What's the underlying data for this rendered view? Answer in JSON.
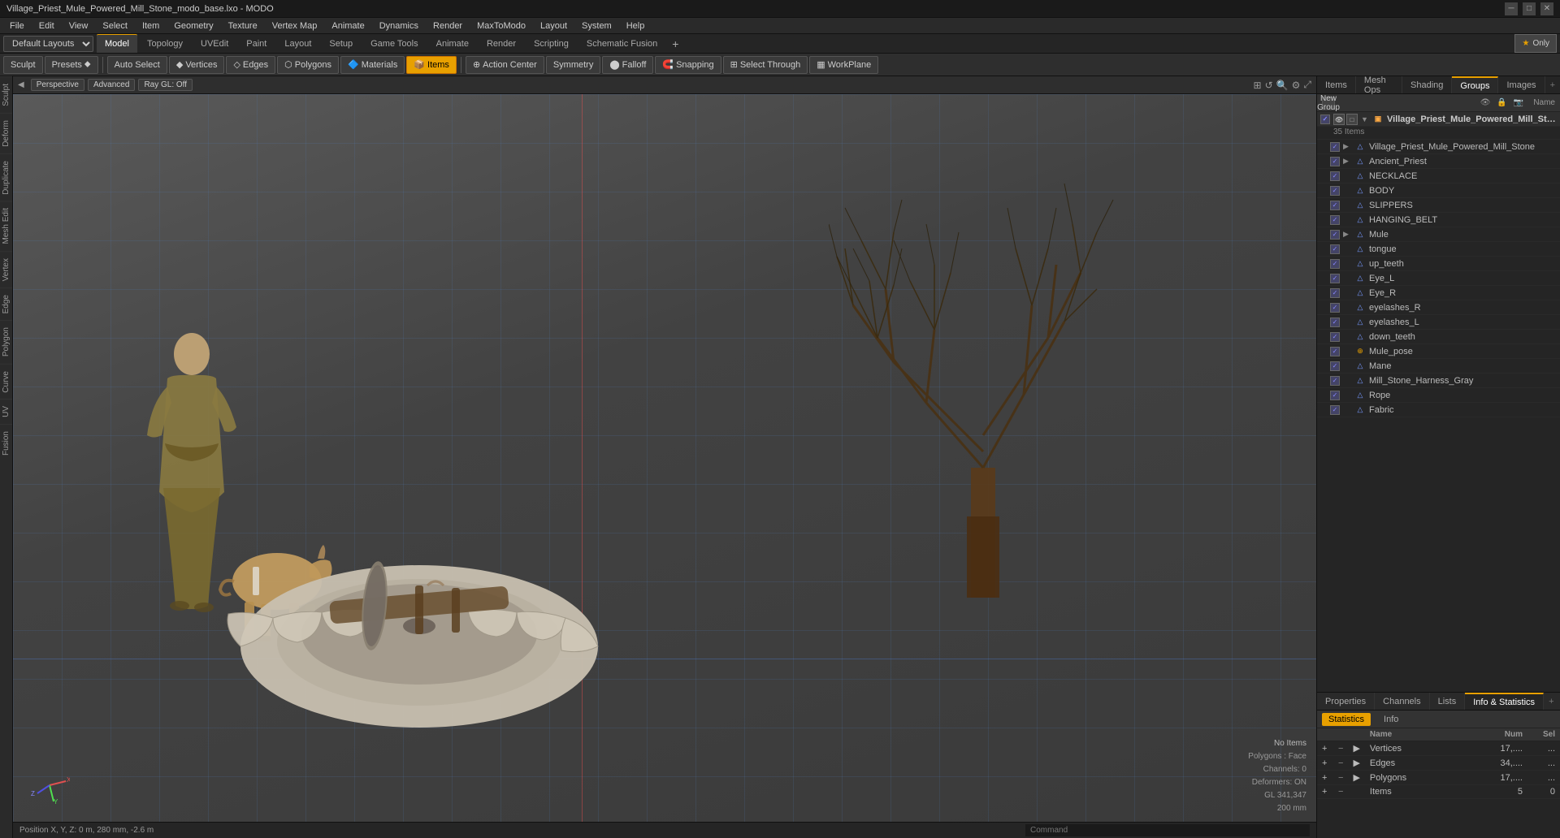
{
  "titlebar": {
    "title": "Village_Priest_Mule_Powered_Mill_Stone_modo_base.lxo - MODO",
    "minimize": "─",
    "maximize": "□",
    "close": "✕"
  },
  "menubar": {
    "items": [
      "File",
      "Edit",
      "View",
      "Select",
      "Item",
      "Geometry",
      "Texture",
      "Vertex Map",
      "Animate",
      "Dynamics",
      "Render",
      "MaxToModo",
      "Layout",
      "System",
      "Help"
    ]
  },
  "layout": {
    "dropdown_label": "Default Layouts",
    "tabs": [
      "Model",
      "Topology",
      "UVEdit",
      "Paint",
      "Layout",
      "Setup",
      "Game Tools",
      "Animate",
      "Render",
      "Scripting",
      "Schematic Fusion"
    ],
    "active_tab": "Model",
    "plus_label": "+",
    "only_btn": "Only",
    "star": "★"
  },
  "toolbar": {
    "sculpt_label": "Sculpt",
    "presets_label": "Presets",
    "auto_select_label": "Auto Select",
    "vertices_label": "Vertices",
    "edges_label": "Edges",
    "polygons_label": "Polygons",
    "materials_label": "Materials",
    "items_label": "Items",
    "action_center_label": "Action Center",
    "symmetry_label": "Symmetry",
    "falloff_label": "Falloff",
    "snapping_label": "Snapping",
    "select_through_label": "Select Through",
    "workplane_label": "WorkPlane"
  },
  "viewport": {
    "perspective_label": "Perspective",
    "advanced_label": "Advanced",
    "ray_gl_label": "Ray GL: Off"
  },
  "right_panel": {
    "tabs": [
      "Items",
      "Mesh Ops",
      "Shading",
      "Groups",
      "Images"
    ],
    "active_tab": "Groups",
    "plus": "+",
    "new_group_label": "New Group",
    "name_col": "Name",
    "scene": {
      "group_name": "Village_Priest_Mule_Powered_Mill_Stone...",
      "item_count": "35 Items",
      "items": [
        "Village_Priest_Mule_Powered_Mill_Stone",
        "Ancient_Priest",
        "NECKLACE",
        "BODY",
        "SLIPPERS",
        "HANGING_BELT",
        "Mule",
        "tongue",
        "up_teeth",
        "Eye_L",
        "Eye_R",
        "eyelashes_R",
        "eyelashes_L",
        "down_teeth",
        "Mule_pose",
        "Mane",
        "Mill_Stone_Harness_Gray",
        "Rope",
        "Fabric"
      ]
    }
  },
  "bottom_panel": {
    "tabs": [
      "Properties",
      "Channels",
      "Lists",
      "Info & Statistics"
    ],
    "active_tab": "Info & Statistics",
    "plus": "+",
    "stats_label": "Statistics",
    "info_label": "Info",
    "stats_cols": {
      "name": "Name",
      "num": "Num",
      "sel": "Sel"
    },
    "stats_rows": [
      {
        "label": "Vertices",
        "num": "17,...",
        "sel": "..."
      },
      {
        "label": "Edges",
        "num": "34,...",
        "sel": "..."
      },
      {
        "label": "Polygons",
        "num": "17,...",
        "sel": "..."
      },
      {
        "label": "Items",
        "num": "5",
        "sel": "0"
      }
    ]
  },
  "viewport_info": {
    "no_items": "No Items",
    "polygons_face": "Polygons : Face",
    "channels": "Channels: 0",
    "deformers": "Deformers: ON",
    "gl": "GL 341,347",
    "size": "200 mm"
  },
  "statusbar": {
    "position": "Position X, Y, Z:  0 m, 280 mm, -2.6 m",
    "command_placeholder": "Command"
  }
}
